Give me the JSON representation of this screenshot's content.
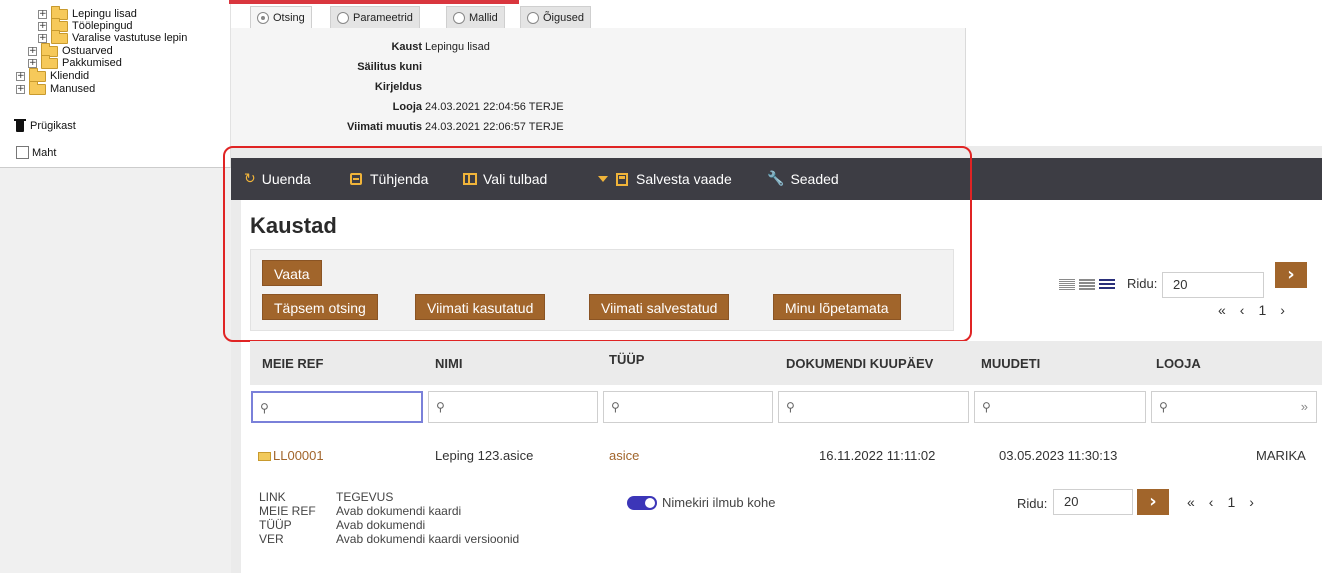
{
  "tree": {
    "items": [
      {
        "label": "Lepingu lisad",
        "indent": 2
      },
      {
        "label": "Töölepingud",
        "indent": 2
      },
      {
        "label": "Varalise vastutuse lepin",
        "indent": 2
      },
      {
        "label": "Ostuarved",
        "indent": 1
      },
      {
        "label": "Pakkumised",
        "indent": 1
      },
      {
        "label": "Kliendid",
        "indent": 0
      },
      {
        "label": "Manused",
        "indent": 0
      }
    ],
    "trash_label": "Prügikast",
    "size_label": "Maht"
  },
  "tabs": [
    {
      "label": "Otsing",
      "selected": true
    },
    {
      "label": "Parameetrid",
      "selected": false
    },
    {
      "label": "Mallid",
      "selected": false
    },
    {
      "label": "Õigused",
      "selected": false
    }
  ],
  "info": {
    "folder_label": "Kaust",
    "folder_value": "Lepingu lisad",
    "keep_label": "Säilitus kuni",
    "keep_value": "",
    "desc_label": "Kirjeldus",
    "desc_value": "",
    "creator_label": "Looja",
    "creator_value": "24.03.2021 22:04:56 TERJE",
    "modified_label": "Viimati muutis",
    "modified_value": "24.03.2021 22:06:57 TERJE"
  },
  "toolbar": {
    "refresh": "Uuenda",
    "clear": "Tühjenda",
    "columns": "Vali tulbad",
    "save_view": "Salvesta vaade",
    "settings": "Seaded"
  },
  "page": {
    "title": "Kaustad"
  },
  "buttons": {
    "view": "Vaata",
    "advanced": "Täpsem otsing",
    "recent_used": "Viimati kasutatud",
    "recent_saved": "Viimati salvestatud",
    "my_unfinished": "Minu lõpetamata"
  },
  "paging": {
    "rows_label": "Ridu:",
    "rows_value": "20",
    "page": "1",
    "first": "«",
    "prev": "‹",
    "next": "›"
  },
  "table": {
    "columns": [
      "MEIE REF",
      "NIMI",
      "TÜÜP",
      "DOKUMENDI KUUPÄEV",
      "MUUDETI",
      "LOOJA"
    ],
    "rows": [
      {
        "ref": "LL00001",
        "name": "Leping 123.asice",
        "type": "asice",
        "doc_date": "16.11.2022 11:11:02",
        "modified": "03.05.2023 11:30:13",
        "creator": "MARIKA"
      }
    ],
    "filter_more": "»"
  },
  "legend": {
    "col1": [
      "LINK",
      "MEIE REF",
      "TÜÜP",
      "VER"
    ],
    "col2": [
      "TEGEVUS",
      "Avab dokumendi kaardi",
      "Avab dokumendi",
      "Avab dokumendi kaardi versioonid"
    ],
    "toggle_label": "Nimekiri ilmub kohe",
    "toggle_on": true
  },
  "colors": {
    "accent": "#a1652b",
    "toolbar_bg": "#3d3d44",
    "highlight": "#e02424",
    "toggle": "#3c36b8"
  }
}
